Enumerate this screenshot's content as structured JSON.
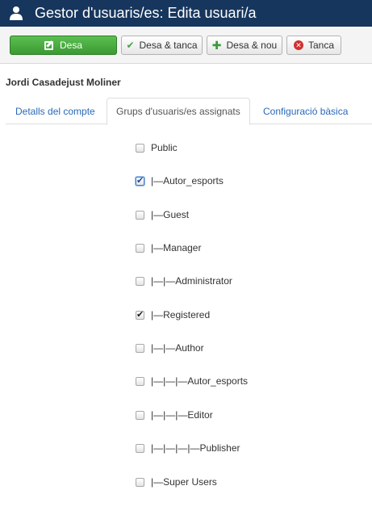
{
  "header": {
    "title": "Gestor d'usuaris/es: Edita usuari/a",
    "icon": "user-icon",
    "background": "#17365d"
  },
  "toolbar": {
    "save_label": "Desa",
    "save_close_label": "Desa & tanca",
    "save_new_label": "Desa & nou",
    "close_label": "Tanca"
  },
  "user_name": "Jordi Casadejust Moliner",
  "tabs": [
    {
      "label": "Detalls del compte",
      "active": false
    },
    {
      "label": "Grups d'usuaris/es assignats",
      "active": true
    },
    {
      "label": "Configuració bàsica",
      "active": false
    }
  ],
  "groups": [
    {
      "label": "Public",
      "checked": false
    },
    {
      "label": "|—Autor_esports",
      "checked": true
    },
    {
      "label": "|—Guest",
      "checked": false
    },
    {
      "label": "|—Manager",
      "checked": false
    },
    {
      "label": "|—|—Administrator",
      "checked": false
    },
    {
      "label": "|—Registered",
      "checked": true
    },
    {
      "label": "|—|—Author",
      "checked": false
    },
    {
      "label": "|—|—|—Autor_esports",
      "checked": false
    },
    {
      "label": "|—|—|—Editor",
      "checked": false
    },
    {
      "label": "|—|—|—|—Publisher",
      "checked": false
    },
    {
      "label": "|—Super Users",
      "checked": false
    }
  ],
  "colors": {
    "save_button": "#46a546",
    "link": "#2a69b8",
    "close_icon": "#d12f2f"
  }
}
